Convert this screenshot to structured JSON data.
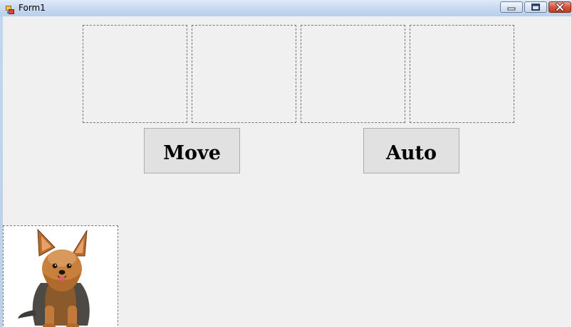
{
  "window": {
    "title": "Form1",
    "icon": "winforms-app-icon",
    "controls": {
      "minimize_icon": "minimize-icon",
      "maximize_icon": "maximize-icon",
      "close_icon": "close-icon"
    }
  },
  "picture_boxes": [
    {
      "name": "picture-box-1",
      "empty": true
    },
    {
      "name": "picture-box-2",
      "empty": true
    },
    {
      "name": "picture-box-3",
      "empty": true
    },
    {
      "name": "picture-box-4",
      "empty": true
    }
  ],
  "buttons": {
    "move_label": "Move",
    "auto_label": "Auto"
  },
  "dog_picture": {
    "subject": "yorkshire-terrier",
    "background": "#ffffff"
  },
  "colors": {
    "client_background": "#f0f0f0",
    "button_face": "#e1e1e1",
    "close_button": "#c63a22"
  }
}
